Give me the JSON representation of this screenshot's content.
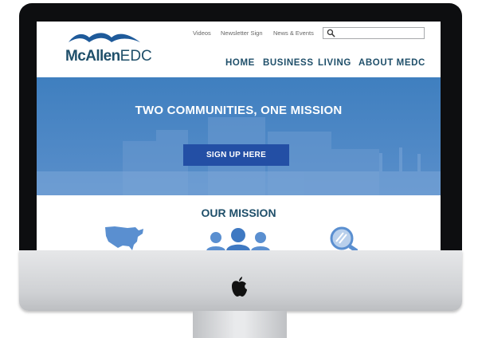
{
  "site": {
    "logo": {
      "name": "McAllen",
      "suffix": "EDC"
    },
    "utility_links": [
      "Videos",
      "Newsletter Sign",
      "News & Events"
    ],
    "search": {
      "value": "",
      "placeholder": ""
    },
    "nav": [
      "HOME",
      "BUSINESS",
      "LIVING",
      "ABOUT MEDC"
    ],
    "hero": {
      "title": "TWO COMMUNITIES, ONE MISSION",
      "cta_label": "SIGN UP HERE"
    },
    "mission": {
      "title": "OUR MISSION",
      "icons": [
        "us-map-icon",
        "people-group-icon",
        "magnifier-icon"
      ]
    }
  },
  "colors": {
    "brand_navy": "#1f4f6a",
    "logo_wave": "#1e5a9a",
    "hero_blue": "#4b84bf",
    "button_blue": "#234fa5",
    "icon_blue": "#5a8fd0"
  }
}
